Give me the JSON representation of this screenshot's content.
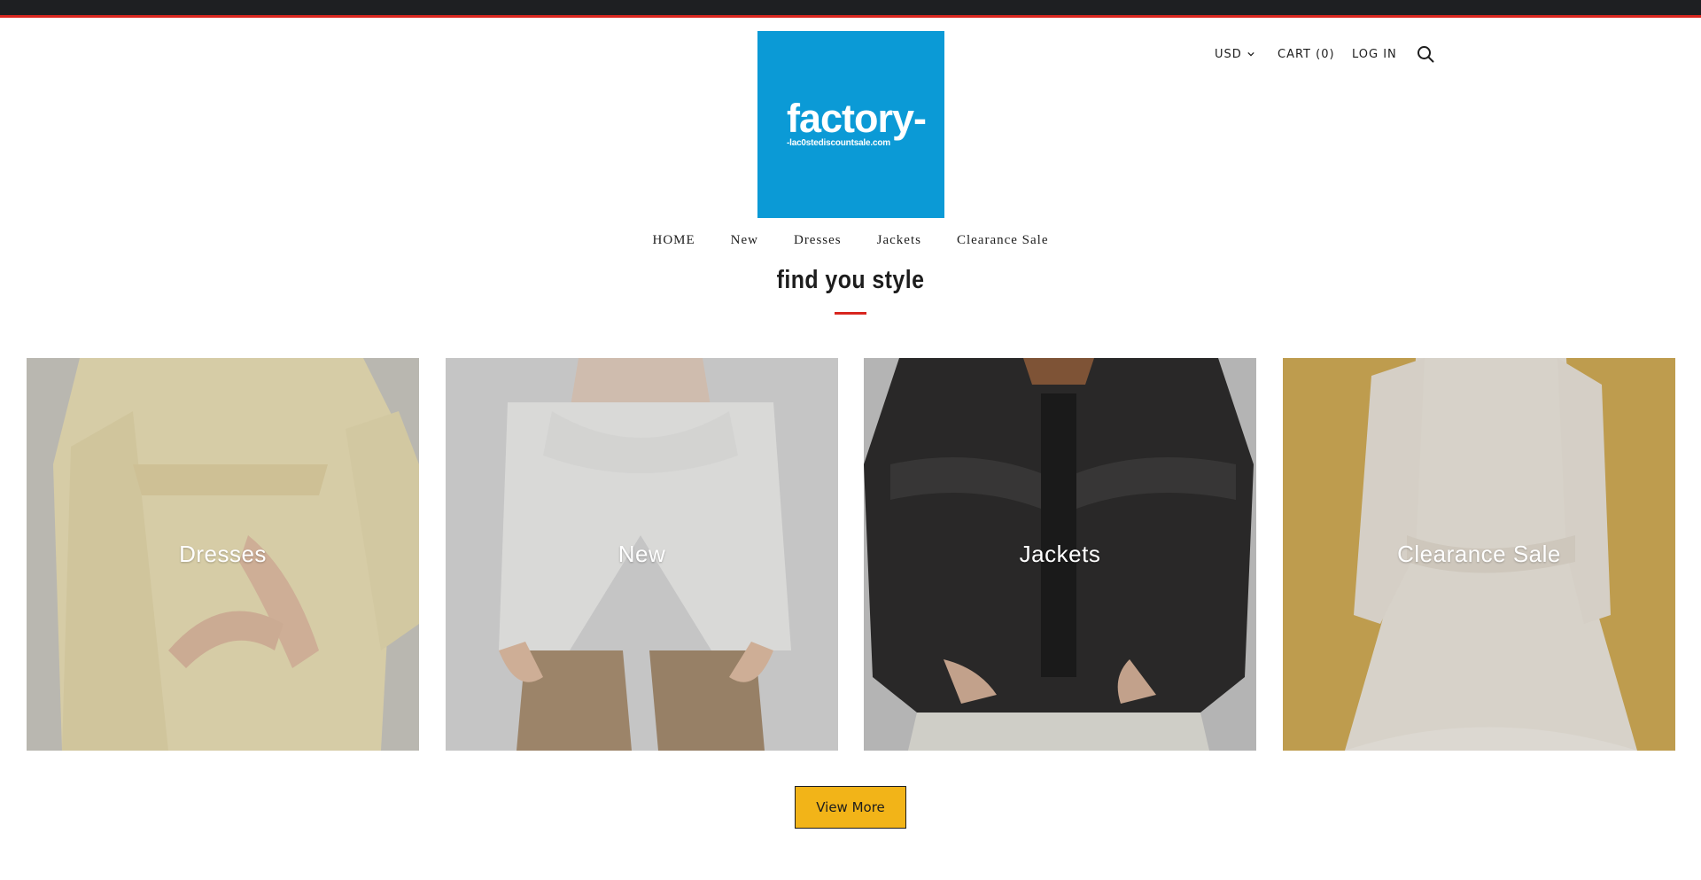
{
  "header": {
    "logo": {
      "main": "factory-",
      "sub": "-lac0stediscountsale.com",
      "color": "#0b9ad6"
    },
    "currency": {
      "selected": "USD",
      "icon": "chevron-down-icon"
    },
    "cart_label": "CART (0)",
    "login_label": "LOG IN",
    "search_icon": "search-icon"
  },
  "nav": {
    "items": [
      {
        "label": "HOME"
      },
      {
        "label": "New"
      },
      {
        "label": "Dresses"
      },
      {
        "label": "Jackets"
      },
      {
        "label": "Clearance Sale"
      }
    ]
  },
  "main": {
    "heading": "find you style",
    "collections": [
      {
        "label": "Dresses"
      },
      {
        "label": "New"
      },
      {
        "label": "Jackets"
      },
      {
        "label": "Clearance Sale"
      }
    ],
    "view_more_label": "View More"
  },
  "colors": {
    "accent": "#d8261f",
    "topbar": "#1e1f22",
    "button": "#f2b418"
  }
}
